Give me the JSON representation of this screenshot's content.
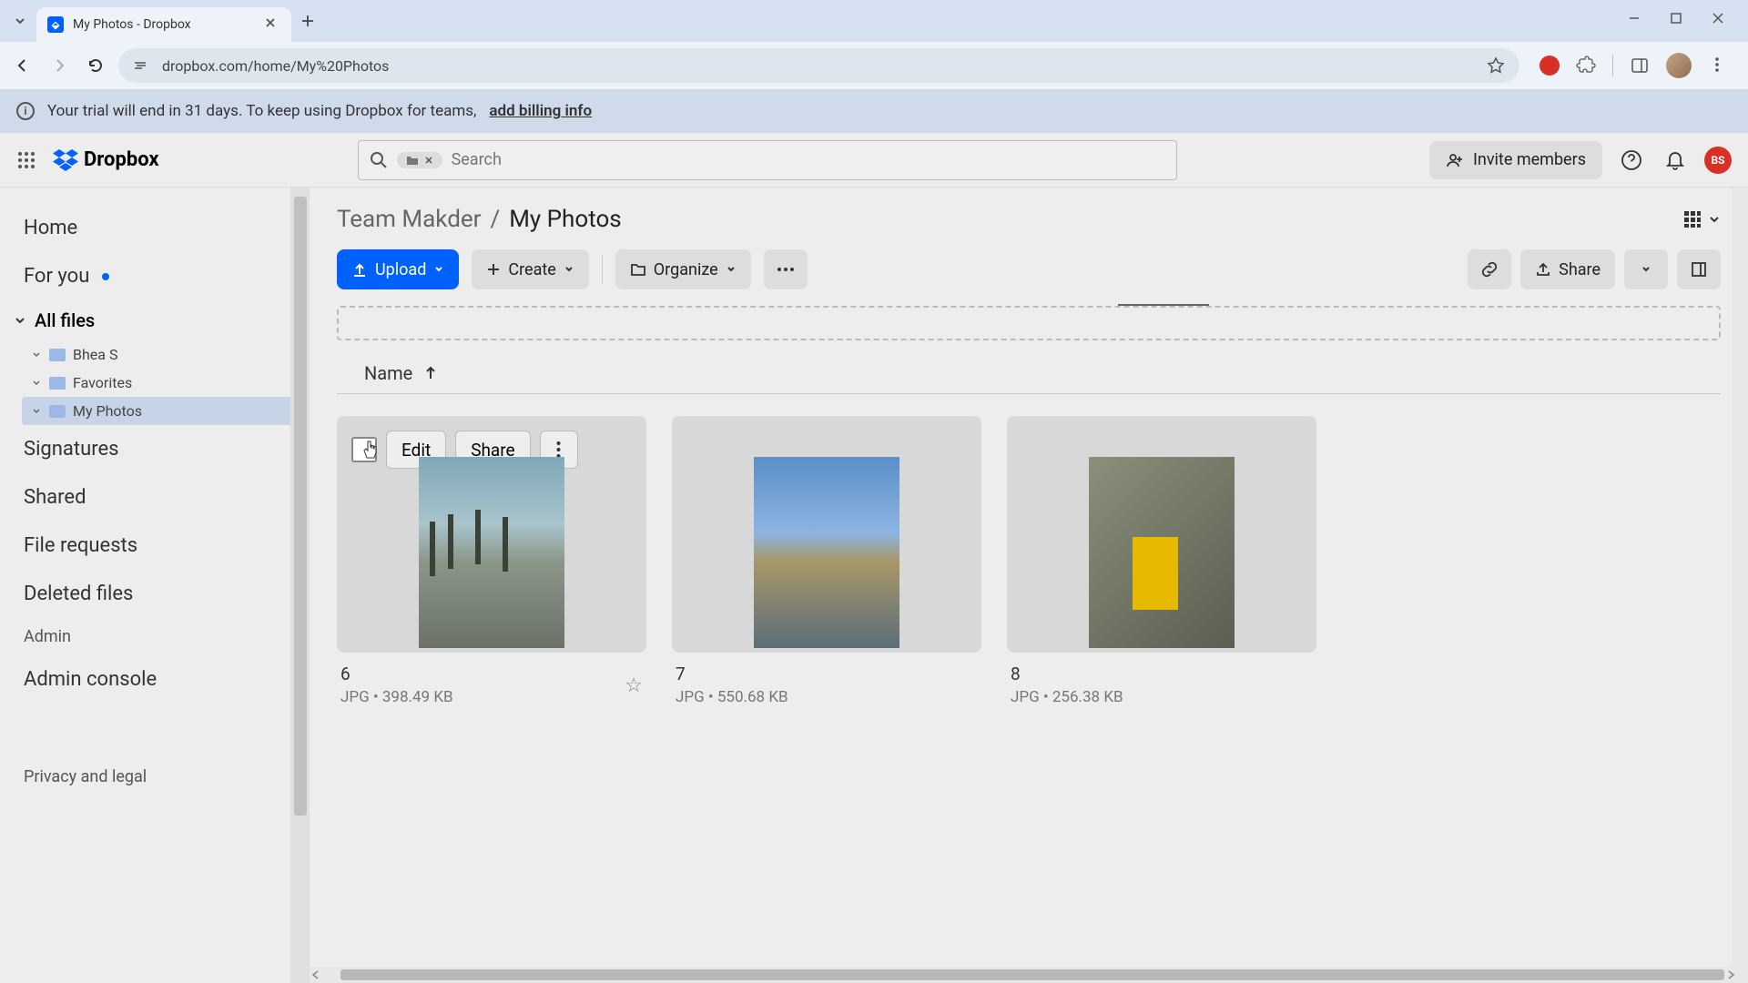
{
  "browser": {
    "tab_title": "My Photos - Dropbox",
    "url": "dropbox.com/home/My%20Photos"
  },
  "banner": {
    "text": "Your trial will end in 31 days. To keep using Dropbox for teams,",
    "link": "add billing info"
  },
  "topbar": {
    "logo": "Dropbox",
    "search_placeholder": "Search",
    "invite": "Invite members",
    "user_initials": "BS"
  },
  "sidebar": {
    "home": "Home",
    "for_you": "For you",
    "all_files": "All files",
    "tree": [
      {
        "label": "Bhea S"
      },
      {
        "label": "Favorites"
      },
      {
        "label": "My Photos"
      }
    ],
    "signatures": "Signatures",
    "shared": "Shared",
    "file_requests": "File requests",
    "deleted": "Deleted files",
    "admin": "Admin",
    "admin_console": "Admin console",
    "privacy": "Privacy and legal"
  },
  "breadcrumb": {
    "parent": "Team Makder",
    "current": "My Photos"
  },
  "actions": {
    "upload": "Upload",
    "create": "Create",
    "organize": "Organize",
    "share": "Share"
  },
  "column_header": "Name",
  "hover_actions": {
    "edit": "Edit",
    "share": "Share"
  },
  "files": [
    {
      "name": "6",
      "type": "JPG",
      "size": "398.49 KB"
    },
    {
      "name": "7",
      "type": "JPG",
      "size": "550.68 KB"
    },
    {
      "name": "8",
      "type": "JPG",
      "size": "256.38 KB"
    }
  ]
}
